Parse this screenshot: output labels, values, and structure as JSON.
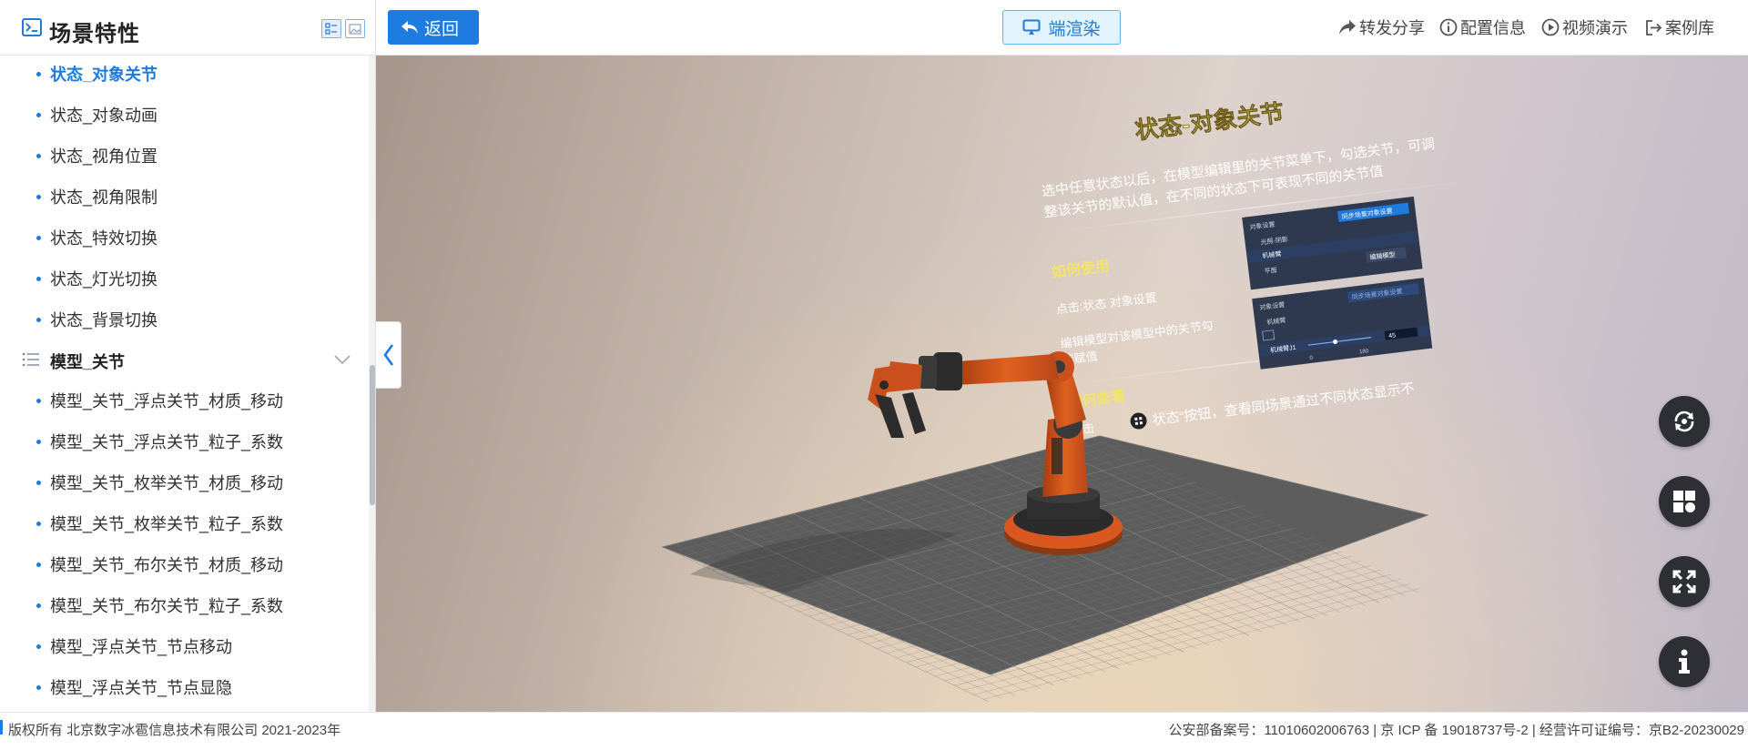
{
  "sidebar": {
    "title": "场景特性",
    "items": [
      {
        "label": "状态_对象关节",
        "active": true
      },
      {
        "label": "状态_对象动画"
      },
      {
        "label": "状态_视角位置"
      },
      {
        "label": "状态_视角限制"
      },
      {
        "label": "状态_特效切换"
      },
      {
        "label": "状态_灯光切换"
      },
      {
        "label": "状态_背景切换"
      }
    ],
    "group": {
      "label": "模型_关节",
      "items": [
        {
          "label": "模型_关节_浮点关节_材质_移动"
        },
        {
          "label": "模型_关节_浮点关节_粒子_系数"
        },
        {
          "label": "模型_关节_枚举关节_材质_移动"
        },
        {
          "label": "模型_关节_枚举关节_粒子_系数"
        },
        {
          "label": "模型_关节_布尔关节_材质_移动"
        },
        {
          "label": "模型_关节_布尔关节_粒子_系数"
        },
        {
          "label": "模型_浮点关节_节点移动"
        },
        {
          "label": "模型_浮点关节_节点显隐"
        }
      ]
    }
  },
  "topbar": {
    "back_label": "返回",
    "render_label": "端渲染",
    "actions": [
      {
        "label": "转发分享",
        "icon": "share-icon"
      },
      {
        "label": "配置信息",
        "icon": "info-circle-icon"
      },
      {
        "label": "视频演示",
        "icon": "play-circle-icon"
      },
      {
        "label": "案例库",
        "icon": "export-icon"
      }
    ]
  },
  "scene": {
    "board_title": "状态-对象关节",
    "board_desc_1": "选中任意状态以后，在模型编辑里的关节菜单下，勾选关节，可调",
    "board_desc_2": "整该关节的默认值，在不同的状态下可表现不同的关节值",
    "how_to_use": "如何使用",
    "step_1": "点击:状态 对象设置",
    "step_2a": "编辑模型对该模型中的关节勾",
    "step_2b": "选赋值",
    "how_to_view": "如何查看",
    "view_prefix": "点击",
    "view_text": "状态“按钮，查看同场景通过不同状态显示不",
    "panel1_title": "对象设置",
    "panel1_button": "同步场景对象设置",
    "panel1_row1": "光照-阴影",
    "panel1_row2": "机械臂",
    "panel1_row3": "平面",
    "panel1_tag": "编辑模型",
    "panel2_title": "对象设置",
    "panel2_button": "同步场景对象设置",
    "panel2_row1": "机械臂",
    "panel2_row3": "机械臂J1",
    "panel2_value": "45",
    "panel2_min": "0",
    "panel2_max": "180"
  },
  "controls": [
    {
      "icon": "rotate-view-icon"
    },
    {
      "icon": "state-grid-icon"
    },
    {
      "icon": "fullscreen-icon"
    },
    {
      "icon": "info-icon"
    }
  ],
  "footer": {
    "left": "版权所有 北京数字冰雹信息技术有限公司 2021-2023年",
    "right": "公安部备案号：11010602006763 | 京 ICP 备 19018737号-2 | 经营许可证编号：京B2-20230029"
  },
  "colors": {
    "accent": "#1e7be0",
    "render_bg": "#e3f3fd",
    "control_bg": "#2d2f34",
    "robot_orange": "#d9581f",
    "board_title": "#f3e46b"
  }
}
